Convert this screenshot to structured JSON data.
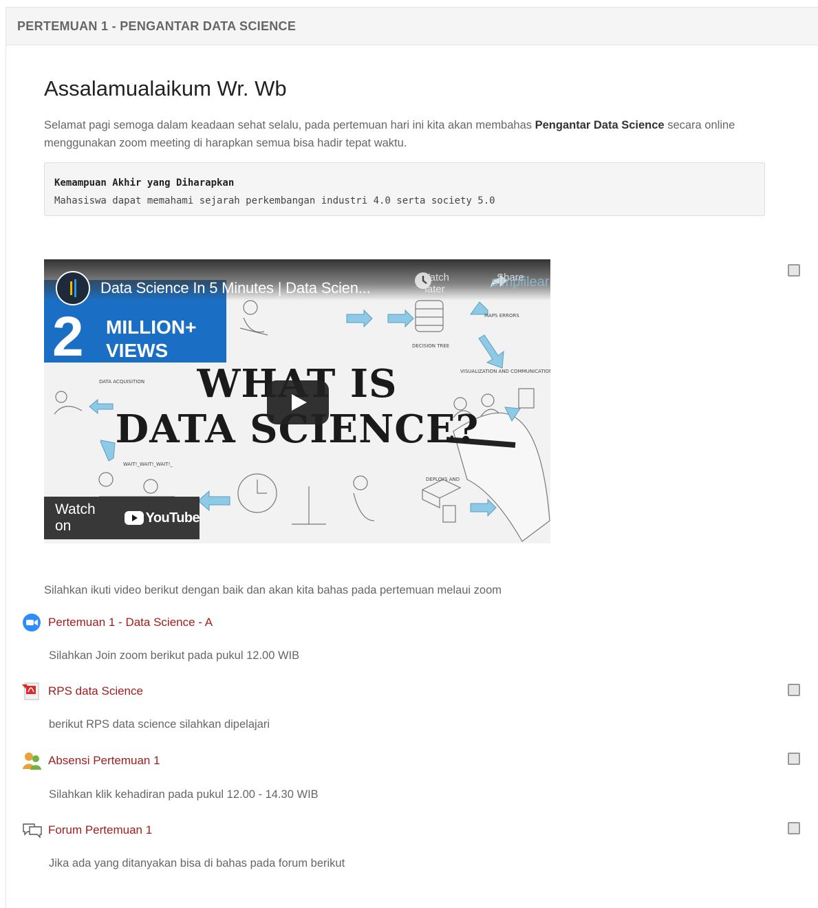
{
  "section": {
    "title": "PERTEMUAN 1 - PENGANTAR DATA SCIENCE"
  },
  "intro": {
    "greeting": "Assalamualaikum Wr. Wb",
    "text_before": "Selamat pagi semoga dalam keadaan sehat selalu, pada pertemuan hari ini kita akan membahas ",
    "text_bold": "Pengantar Data Science",
    "text_after": " secara online menggunakan zoom meeting di harapkan semua bisa hadir tepat waktu."
  },
  "objective": {
    "title": "Kemampuan Akhir yang Diharapkan",
    "text": "Mahasiswa dapat memahami sejarah perkembangan industri 4.0 serta society 5.0"
  },
  "video": {
    "title": "Data Science In 5 Minutes | Data Scien...",
    "watch_later": "Watch later",
    "share": "Share",
    "banner_number": "2",
    "banner_text_1": "MILLION+",
    "banner_text_2": "VIEWS",
    "headline_1": "WHAT IS",
    "headline_2": "DATA SCIENCE?",
    "watch_on": "Watch on",
    "youtube": "YouTube",
    "brand": "simplilearn"
  },
  "after_video_text": "Silahkan ikuti video berikut dengan baik dan akan kita bahas pada pertemuan melaui zoom",
  "activities": [
    {
      "label": "Pertemuan 1 - Data Science - A",
      "icon": "zoom-icon",
      "description": "Silahkan Join zoom berikut pada pukul 12.00 WIB",
      "has_checkbox": false
    },
    {
      "label": "RPS data Science",
      "icon": "pdf-icon",
      "description": "berikut RPS data science silahkan dipelajari",
      "has_checkbox": true
    },
    {
      "label": "Absensi Pertemuan 1",
      "icon": "attendance-icon",
      "description": "Silahkan klik kehadiran pada pukul 12.00 - 14.30 WIB",
      "has_checkbox": true
    },
    {
      "label": "Forum Pertemuan 1",
      "icon": "forum-icon",
      "description": "Jika ada yang ditanyakan  bisa di bahas pada  forum berikut",
      "has_checkbox": true
    }
  ],
  "colors": {
    "link": "#a01d1d",
    "banner": "#1a6fc4",
    "zoom": "#2d8cff"
  }
}
